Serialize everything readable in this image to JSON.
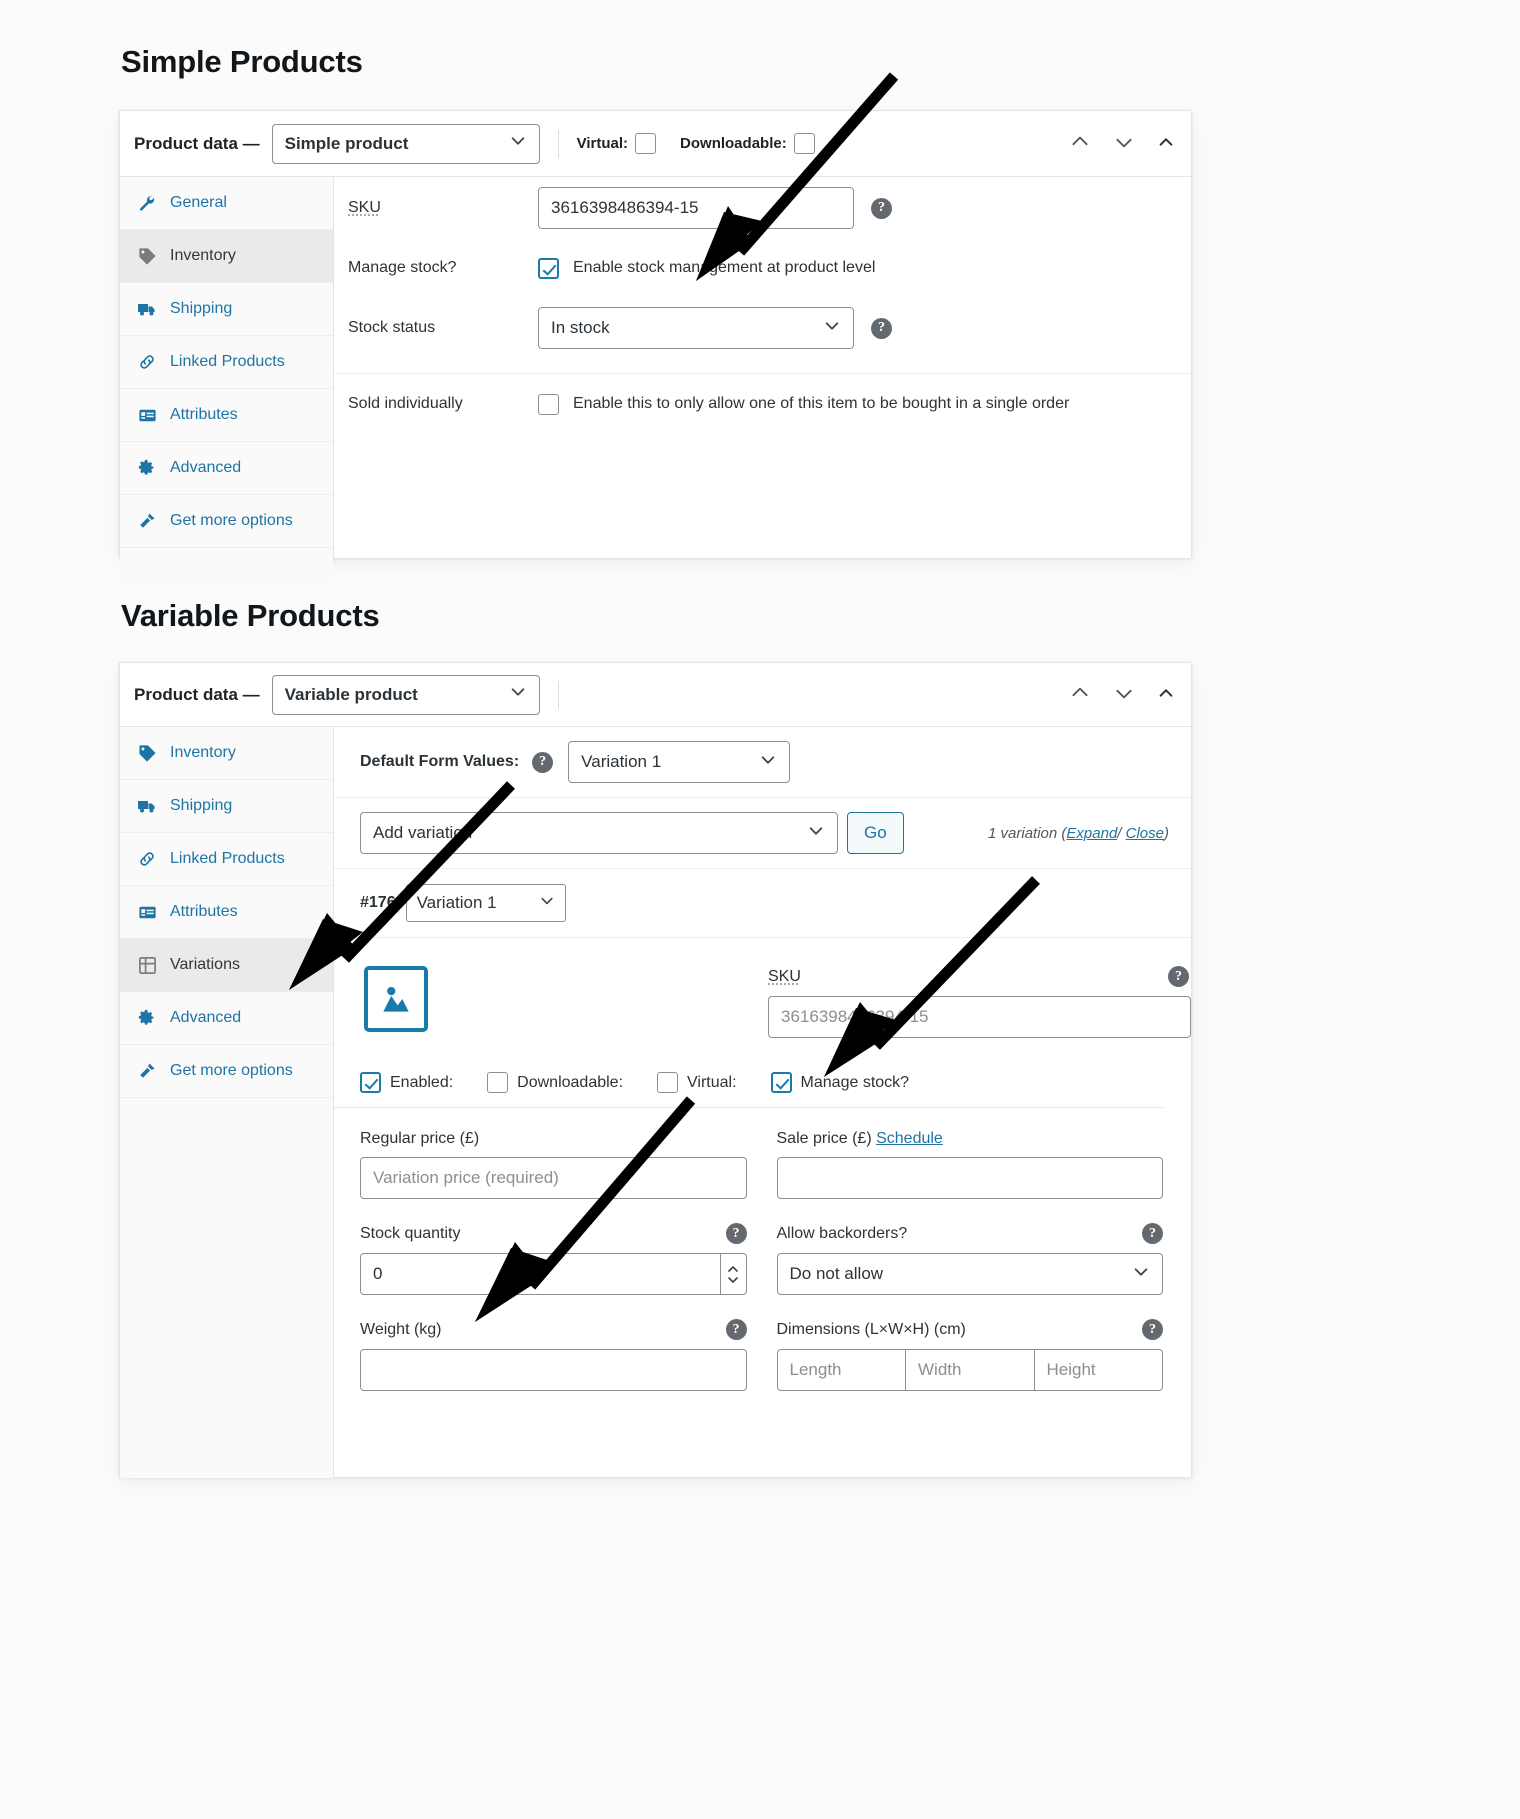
{
  "sections": {
    "simple": {
      "title": "Simple Products"
    },
    "variable": {
      "title": "Variable Products"
    }
  },
  "simple_panel": {
    "header": {
      "product_data_label": "Product data —",
      "product_type": "Simple product",
      "virtual_label": "Virtual:",
      "downloadable_label": "Downloadable:",
      "virtual_checked": false,
      "downloadable_checked": false
    },
    "tabs": [
      {
        "label": "General",
        "icon": "wrench-icon",
        "active": false
      },
      {
        "label": "Inventory",
        "icon": "tag-icon",
        "active": true
      },
      {
        "label": "Shipping",
        "icon": "truck-icon",
        "active": false
      },
      {
        "label": "Linked Products",
        "icon": "link-icon",
        "active": false
      },
      {
        "label": "Attributes",
        "icon": "list-icon",
        "active": false
      },
      {
        "label": "Advanced",
        "icon": "gear-icon",
        "active": false
      },
      {
        "label": "Get more options",
        "icon": "plug-icon",
        "active": false
      }
    ],
    "fields": {
      "sku_label": "SKU",
      "sku_value": "3616398486394-15",
      "manage_stock_label": "Manage stock?",
      "manage_stock_text": "Enable stock management at product level",
      "manage_stock_checked": true,
      "stock_status_label": "Stock status",
      "stock_status_value": "In stock",
      "sold_individually_label": "Sold individually",
      "sold_individually_text": "Enable this to only allow one of this item to be bought in a single order",
      "sold_individually_checked": false
    }
  },
  "variable_panel": {
    "header": {
      "product_data_label": "Product data —",
      "product_type": "Variable product"
    },
    "tabs": [
      {
        "label": "Inventory",
        "icon": "tag-icon",
        "active": false
      },
      {
        "label": "Shipping",
        "icon": "truck-icon",
        "active": false
      },
      {
        "label": "Linked Products",
        "icon": "link-icon",
        "active": false
      },
      {
        "label": "Attributes",
        "icon": "list-icon",
        "active": false
      },
      {
        "label": "Variations",
        "icon": "grid-icon",
        "active": true
      },
      {
        "label": "Advanced",
        "icon": "gear-icon",
        "active": false
      },
      {
        "label": "Get more options",
        "icon": "plug-icon",
        "active": false
      }
    ],
    "default_form_values": {
      "label": "Default Form Values:",
      "value": "Variation 1"
    },
    "add_variation": {
      "select_value": "Add variation",
      "go_label": "Go",
      "count_text": "1 variation",
      "expand_label": "Expand",
      "separator": "/",
      "close_label": "Close"
    },
    "variation": {
      "id": "#176",
      "name": "Variation 1",
      "image_icon": "image-placeholder-icon",
      "sku_label": "SKU",
      "sku_placeholder": "3616398486394-15",
      "checks": [
        {
          "label": "Enabled:",
          "checked": true
        },
        {
          "label": "Downloadable:",
          "checked": false
        },
        {
          "label": "Virtual:",
          "checked": false
        },
        {
          "label": "Manage stock?",
          "checked": true
        }
      ],
      "regular_price_label": "Regular price (£)",
      "regular_price_placeholder": "Variation price (required)",
      "sale_price_label": "Sale price (£)",
      "sale_price_schedule": "Schedule",
      "sale_price_value": "",
      "stock_qty_label": "Stock quantity",
      "stock_qty_value": "0",
      "backorders_label": "Allow backorders?",
      "backorders_value": "Do not allow",
      "weight_label": "Weight (kg)",
      "weight_value": "",
      "dimensions_label": "Dimensions (L×W×H) (cm)",
      "dim_length_placeholder": "Length",
      "dim_width_placeholder": "Width",
      "dim_height_placeholder": "Height"
    }
  },
  "colors": {
    "accent": "#1d74a5",
    "checkbox_checked": "#1a7bab",
    "active_tab_bg": "#eaeaea"
  }
}
